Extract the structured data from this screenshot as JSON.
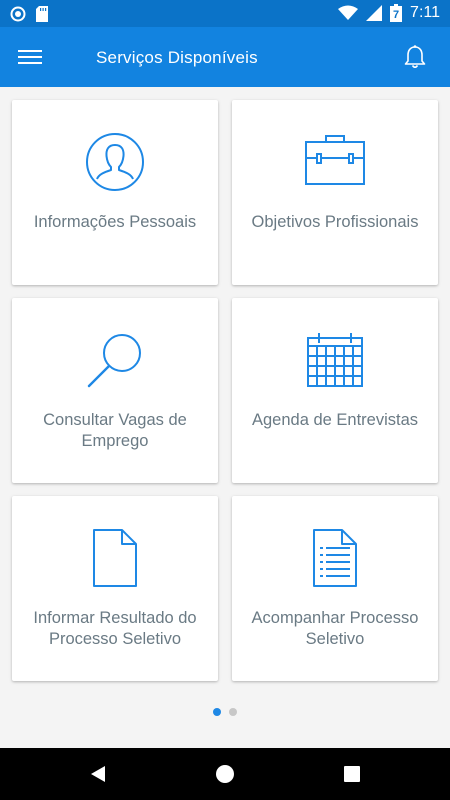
{
  "status_bar": {
    "time": "7:11",
    "battery_icon_text": "7",
    "left_icons": [
      "sync-icon",
      "sd-card-icon"
    ],
    "right_icons": [
      "wifi-icon",
      "signal-icon",
      "battery-icon"
    ]
  },
  "app_bar": {
    "title": "Serviços Disponíveis",
    "menu_icon": "hamburger-menu-icon",
    "notification_icon": "bell-icon"
  },
  "services": [
    {
      "label": "Informações Pessoais",
      "icon": "person-icon"
    },
    {
      "label": "Objetivos Profissionais",
      "icon": "briefcase-icon"
    },
    {
      "label": "Consultar Vagas de Emprego",
      "icon": "search-icon"
    },
    {
      "label": "Agenda de Entrevistas",
      "icon": "calendar-icon"
    },
    {
      "label": "Informar Resultado do Processo Seletivo",
      "icon": "document-icon"
    },
    {
      "label": "Acompanhar Processo Seletivo",
      "icon": "document-lines-icon"
    }
  ],
  "pagination": {
    "pages": 2,
    "current": 1
  },
  "colors": {
    "status_bar": "#0b73c8",
    "app_bar": "#1283e0",
    "accent": "#1e88e5",
    "label_text": "#6a7a84",
    "dot_active": "#1e88e5",
    "dot_inactive": "#c7c7c7"
  },
  "nav_bar": {
    "icons": [
      "back-icon",
      "home-icon",
      "recents-icon"
    ]
  }
}
